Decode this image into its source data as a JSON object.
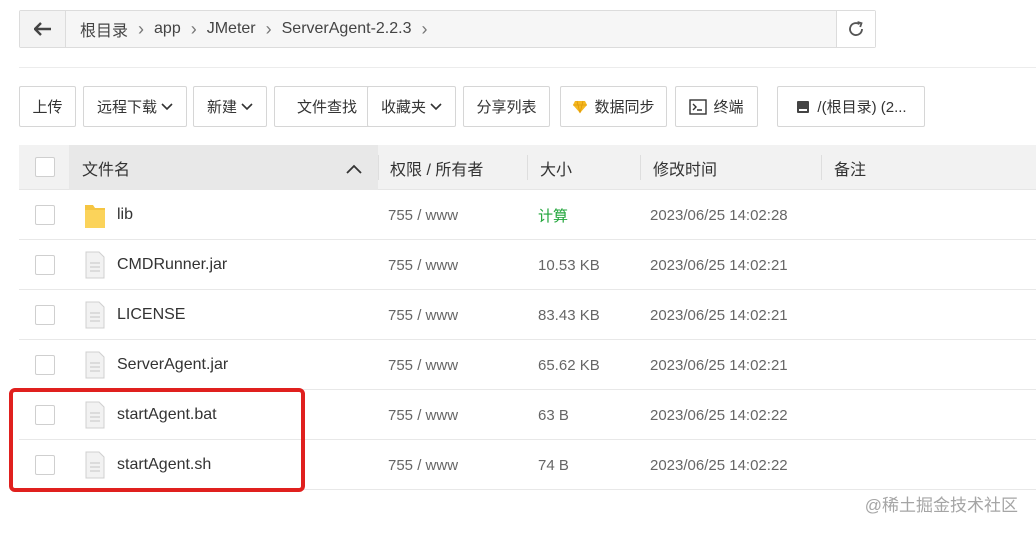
{
  "pathbar": {
    "crumbs": [
      "根目录",
      "app",
      "JMeter",
      "ServerAgent-2.2.3"
    ]
  },
  "toolbar": {
    "upload": "上传",
    "remote_download": "远程下载",
    "new": "新建",
    "file_search": "文件查找",
    "favorites": "收藏夹",
    "share_list": "分享列表",
    "data_sync": "数据同步",
    "terminal": "终端",
    "disk": "/(根目录) (2..."
  },
  "table": {
    "headers": {
      "name": "文件名",
      "perm": "权限 / 所有者",
      "size": "大小",
      "mtime": "修改时间",
      "note": "备注"
    },
    "rows": [
      {
        "type": "folder",
        "name": "lib",
        "perm": "755 / www",
        "size": "计算",
        "mtime": "2023/06/25 14:02:28"
      },
      {
        "type": "file",
        "name": "CMDRunner.jar",
        "perm": "755 / www",
        "size": "10.53 KB",
        "mtime": "2023/06/25 14:02:21"
      },
      {
        "type": "file",
        "name": "LICENSE",
        "perm": "755 / www",
        "size": "83.43 KB",
        "mtime": "2023/06/25 14:02:21"
      },
      {
        "type": "file",
        "name": "ServerAgent.jar",
        "perm": "755 / www",
        "size": "65.62 KB",
        "mtime": "2023/06/25 14:02:21"
      },
      {
        "type": "file",
        "name": "startAgent.bat",
        "perm": "755 / www",
        "size": "63 B",
        "mtime": "2023/06/25 14:02:22"
      },
      {
        "type": "file",
        "name": "startAgent.sh",
        "perm": "755 / www",
        "size": "74 B",
        "mtime": "2023/06/25 14:02:22"
      }
    ]
  },
  "colors": {
    "accent_green": "#20a53a",
    "highlight_red": "#e0201e",
    "header_bg": "#f2f2f2"
  },
  "watermark": "@稀土掘金技术社区"
}
